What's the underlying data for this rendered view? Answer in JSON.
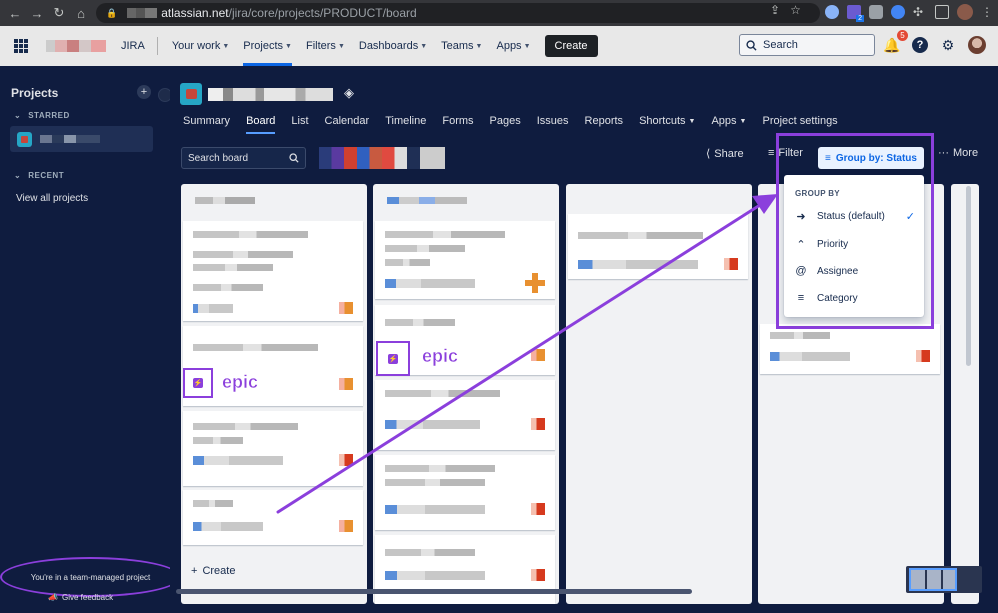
{
  "browser": {
    "url_host": "atlassian.net",
    "url_path": "/jira/core/projects/PRODUCT/board",
    "ext_badge": "2"
  },
  "topnav": {
    "product": "JIRA",
    "items": [
      {
        "label": "Your work"
      },
      {
        "label": "Projects"
      },
      {
        "label": "Filters"
      },
      {
        "label": "Dashboards"
      },
      {
        "label": "Teams"
      },
      {
        "label": "Apps"
      }
    ],
    "create_label": "Create",
    "search_placeholder": "Search",
    "notifications_count": "5"
  },
  "sidebar": {
    "title": "Projects",
    "starred_heading": "STARRED",
    "recent_heading": "RECENT",
    "view_all_label": "View all projects",
    "team_note": "You're in a team-managed project",
    "feedback_label": "Give feedback"
  },
  "project": {
    "tabs": [
      {
        "label": "Summary"
      },
      {
        "label": "Board"
      },
      {
        "label": "List"
      },
      {
        "label": "Calendar"
      },
      {
        "label": "Timeline"
      },
      {
        "label": "Forms"
      },
      {
        "label": "Pages"
      },
      {
        "label": "Issues"
      },
      {
        "label": "Reports"
      },
      {
        "label": "Shortcuts"
      },
      {
        "label": "Apps"
      },
      {
        "label": "Project settings"
      }
    ]
  },
  "board": {
    "search_placeholder": "Search board",
    "share_label": "Share",
    "filter_label": "Filter",
    "groupby_label": "Group by: Status",
    "more_label": "More",
    "create_label": "Create"
  },
  "groupby_menu": {
    "heading": "GROUP BY",
    "options": [
      {
        "label": "Status (default)",
        "icon": "status-icon",
        "selected": true
      },
      {
        "label": "Priority",
        "icon": "priority-icon",
        "selected": false
      },
      {
        "label": "Assignee",
        "icon": "assignee-icon",
        "selected": false
      },
      {
        "label": "Category",
        "icon": "category-icon",
        "selected": false
      }
    ]
  },
  "annotations": {
    "epic_label_1": "epic",
    "epic_label_2": "epic",
    "highlight_color": "#8b3fdc"
  },
  "colors": {
    "accent": "#0c66e4",
    "sidebar_bg": "#0f1c3f",
    "badge": "#e34935"
  }
}
